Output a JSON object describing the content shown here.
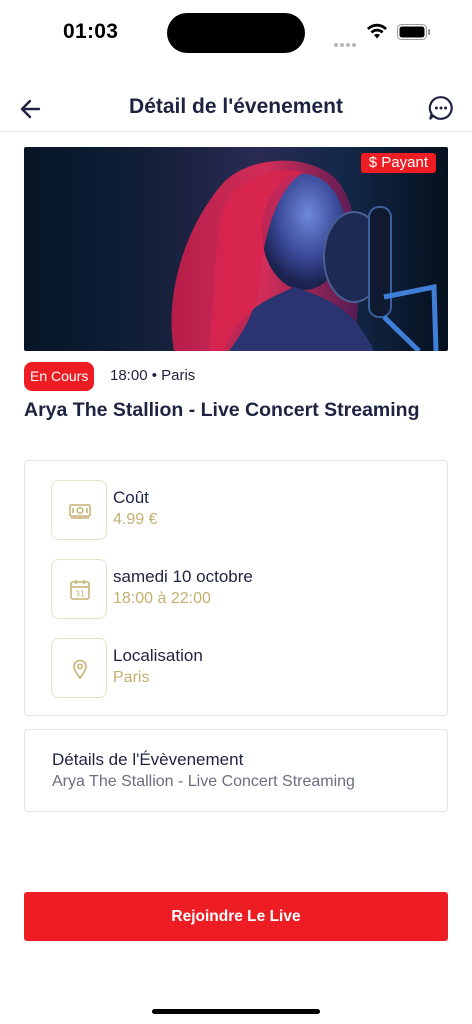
{
  "status_bar": {
    "time": "01:03"
  },
  "header": {
    "title": "Détail de l'évenement"
  },
  "hero": {
    "badge_icon": "dollar-icon",
    "badge_label": "$ Payant"
  },
  "event": {
    "status": "En Cours",
    "time_location": "18:00 • Paris",
    "title": "Arya The Stallion - Live Concert Streaming"
  },
  "info": {
    "items": [
      {
        "icon": "money-icon",
        "label": "Coût",
        "value": "4.99 €"
      },
      {
        "icon": "calendar-icon",
        "label": "samedi 10 octobre",
        "value": "18:00 à 22:00"
      },
      {
        "icon": "location-pin-icon",
        "label": "Localisation",
        "value": "Paris"
      }
    ]
  },
  "details": {
    "heading": "Détails de l'Évèvenement",
    "text": "Arya The Stallion - Live Concert Streaming"
  },
  "actions": {
    "join_label": "Rejoindre Le Live"
  },
  "colors": {
    "accent": "#ee1d23",
    "gold": "#c3b070",
    "text": "#1e2341"
  }
}
